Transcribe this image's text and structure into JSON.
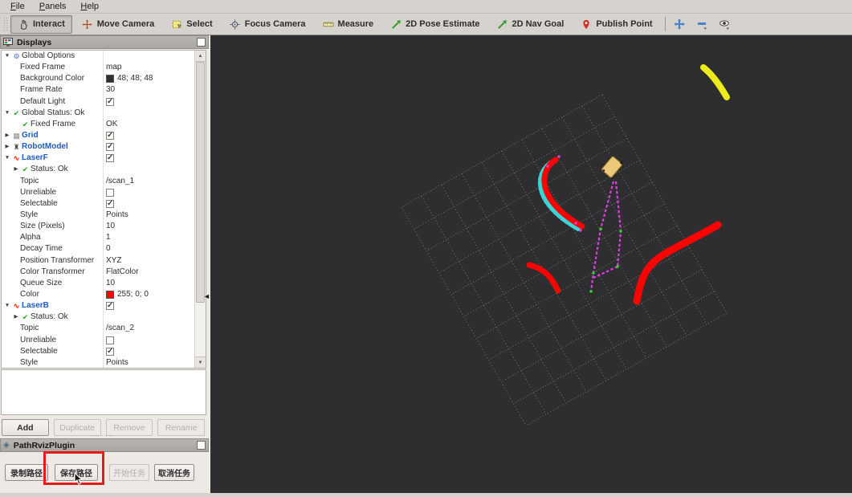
{
  "menu": {
    "items": [
      "File",
      "Panels",
      "Help"
    ]
  },
  "toolbar": {
    "tools": [
      {
        "label": "Interact",
        "icon": "hand-icon",
        "active": true
      },
      {
        "label": "Move Camera",
        "icon": "move-camera-icon",
        "active": false
      },
      {
        "label": "Select",
        "icon": "select-icon",
        "active": false
      },
      {
        "label": "Focus Camera",
        "icon": "focus-camera-icon",
        "active": false
      },
      {
        "label": "Measure",
        "icon": "measure-icon",
        "active": false
      },
      {
        "label": "2D Pose Estimate",
        "icon": "pose-estimate-icon",
        "active": false
      },
      {
        "label": "2D Nav Goal",
        "icon": "nav-goal-icon",
        "active": false
      },
      {
        "label": "Publish Point",
        "icon": "publish-point-icon",
        "active": false
      }
    ],
    "extra_tools": [
      "add-tool-icon",
      "remove-tool-icon",
      "tool-properties-icon"
    ]
  },
  "displays_panel": {
    "title": "Displays",
    "rows": [
      {
        "indent": 0,
        "arrow": "down",
        "icon": "gear",
        "label": "Global Options",
        "blue": false,
        "value": {
          "type": "none"
        }
      },
      {
        "indent": 1,
        "arrow": null,
        "icon": null,
        "label": "Fixed Frame",
        "blue": false,
        "value": {
          "type": "text",
          "text": "map"
        }
      },
      {
        "indent": 1,
        "arrow": null,
        "icon": null,
        "label": "Background Color",
        "blue": false,
        "value": {
          "type": "color",
          "swatch": "#303030",
          "text": "48; 48; 48"
        }
      },
      {
        "indent": 1,
        "arrow": null,
        "icon": null,
        "label": "Frame Rate",
        "blue": false,
        "value": {
          "type": "text",
          "text": "30"
        }
      },
      {
        "indent": 1,
        "arrow": null,
        "icon": null,
        "label": "Default Light",
        "blue": false,
        "value": {
          "type": "checkbox",
          "checked": true
        }
      },
      {
        "indent": 0,
        "arrow": "down",
        "icon": "check",
        "label": "Global Status: Ok",
        "blue": false,
        "value": {
          "type": "none"
        }
      },
      {
        "indent": 1,
        "arrow": null,
        "icon": "check",
        "label": "Fixed Frame",
        "blue": false,
        "value": {
          "type": "text",
          "text": "OK"
        }
      },
      {
        "indent": 0,
        "arrow": "right",
        "icon": "grid",
        "label": "Grid",
        "blue": true,
        "value": {
          "type": "checkbox",
          "checked": true
        }
      },
      {
        "indent": 0,
        "arrow": "right",
        "icon": "robot",
        "label": "RobotModel",
        "blue": true,
        "value": {
          "type": "checkbox",
          "checked": true
        }
      },
      {
        "indent": 0,
        "arrow": "down",
        "icon": "laser",
        "label": "LaserF",
        "blue": true,
        "value": {
          "type": "checkbox",
          "checked": true
        }
      },
      {
        "indent": 1,
        "arrow": "right",
        "icon": "check",
        "label": "Status: Ok",
        "blue": false,
        "value": {
          "type": "none"
        }
      },
      {
        "indent": 1,
        "arrow": null,
        "icon": null,
        "label": "Topic",
        "blue": false,
        "value": {
          "type": "text",
          "text": "/scan_1"
        }
      },
      {
        "indent": 1,
        "arrow": null,
        "icon": null,
        "label": "Unreliable",
        "blue": false,
        "value": {
          "type": "checkbox",
          "checked": false
        }
      },
      {
        "indent": 1,
        "arrow": null,
        "icon": null,
        "label": "Selectable",
        "blue": false,
        "value": {
          "type": "checkbox",
          "checked": true
        }
      },
      {
        "indent": 1,
        "arrow": null,
        "icon": null,
        "label": "Style",
        "blue": false,
        "value": {
          "type": "text",
          "text": "Points"
        }
      },
      {
        "indent": 1,
        "arrow": null,
        "icon": null,
        "label": "Size (Pixels)",
        "blue": false,
        "value": {
          "type": "text",
          "text": "10"
        }
      },
      {
        "indent": 1,
        "arrow": null,
        "icon": null,
        "label": "Alpha",
        "blue": false,
        "value": {
          "type": "text",
          "text": "1"
        }
      },
      {
        "indent": 1,
        "arrow": null,
        "icon": null,
        "label": "Decay Time",
        "blue": false,
        "value": {
          "type": "text",
          "text": "0"
        }
      },
      {
        "indent": 1,
        "arrow": null,
        "icon": null,
        "label": "Position Transformer",
        "blue": false,
        "value": {
          "type": "text",
          "text": "XYZ"
        }
      },
      {
        "indent": 1,
        "arrow": null,
        "icon": null,
        "label": "Color Transformer",
        "blue": false,
        "value": {
          "type": "text",
          "text": "FlatColor"
        }
      },
      {
        "indent": 1,
        "arrow": null,
        "icon": null,
        "label": "Queue Size",
        "blue": false,
        "value": {
          "type": "text",
          "text": "10"
        }
      },
      {
        "indent": 1,
        "arrow": null,
        "icon": null,
        "label": "Color",
        "blue": false,
        "value": {
          "type": "color",
          "swatch": "#ff0000",
          "text": "255; 0; 0"
        }
      },
      {
        "indent": 0,
        "arrow": "down",
        "icon": "laser",
        "label": "LaserB",
        "blue": true,
        "value": {
          "type": "checkbox",
          "checked": true
        }
      },
      {
        "indent": 1,
        "arrow": "right",
        "icon": "check",
        "label": "Status: Ok",
        "blue": false,
        "value": {
          "type": "none"
        }
      },
      {
        "indent": 1,
        "arrow": null,
        "icon": null,
        "label": "Topic",
        "blue": false,
        "value": {
          "type": "text",
          "text": "/scan_2"
        }
      },
      {
        "indent": 1,
        "arrow": null,
        "icon": null,
        "label": "Unreliable",
        "blue": false,
        "value": {
          "type": "checkbox",
          "checked": false
        }
      },
      {
        "indent": 1,
        "arrow": null,
        "icon": null,
        "label": "Selectable",
        "blue": false,
        "value": {
          "type": "checkbox",
          "checked": true
        }
      },
      {
        "indent": 1,
        "arrow": null,
        "icon": null,
        "label": "Style",
        "blue": false,
        "value": {
          "type": "text",
          "text": "Points"
        }
      }
    ],
    "buttons": [
      {
        "label": "Add",
        "enabled": true
      },
      {
        "label": "Duplicate",
        "enabled": false
      },
      {
        "label": "Remove",
        "enabled": false
      },
      {
        "label": "Rename",
        "enabled": false
      }
    ]
  },
  "plugin_panel": {
    "title": "PathRvizPlugin",
    "buttons": [
      {
        "label": "录制路径",
        "enabled": true,
        "highlighted": false
      },
      {
        "label": "保存路径",
        "enabled": true,
        "highlighted": true
      },
      {
        "label": "开始任务",
        "enabled": false,
        "highlighted": false
      },
      {
        "label": "取消任务",
        "enabled": true,
        "highlighted": false
      }
    ]
  },
  "viewport": {
    "background_color": "#2e2e30",
    "grid_color": "#909090",
    "laser_front_color": "#ff0000",
    "laser_back_color": "#ff0000",
    "cyan_points_color": "#3ad4d4",
    "path_color": "#e03ee0",
    "waypoint_color": "#2ed32e",
    "yellow_scan_color": "#ecec1c",
    "robot_body_color": "#eaca78"
  }
}
